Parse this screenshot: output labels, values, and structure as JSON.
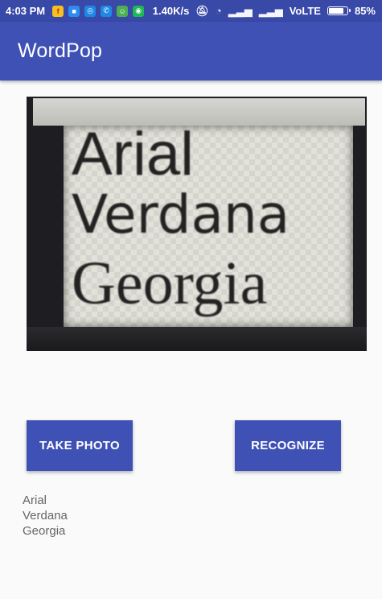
{
  "status_bar": {
    "time": "4:03 PM",
    "speed": "1.40K/s",
    "network": "VoLTE",
    "battery": "85%",
    "battery_level": 0.85,
    "notification_icons": [
      {
        "name": "flipkart-icon",
        "color": "#f4c11f"
      },
      {
        "name": "app-icon",
        "color": "#2d8cf0"
      },
      {
        "name": "messenger-icon",
        "color": "#1e88e5"
      },
      {
        "name": "phone-icon",
        "color": "#1e88e5"
      },
      {
        "name": "android-icon",
        "color": "#4caf50"
      },
      {
        "name": "app-icon-green",
        "color": "#1db954"
      }
    ]
  },
  "app_bar": {
    "title": "WordPop"
  },
  "photo": {
    "lines": [
      "Arial",
      "Verdana",
      "Georgia"
    ]
  },
  "buttons": {
    "take_photo": "TAKE PHOTO",
    "recognize": "RECOGNIZE"
  },
  "results": [
    "Arial",
    "Verdana",
    "Georgia"
  ],
  "colors": {
    "primary": "#3f51b5",
    "primary_dark": "#3849a8"
  }
}
